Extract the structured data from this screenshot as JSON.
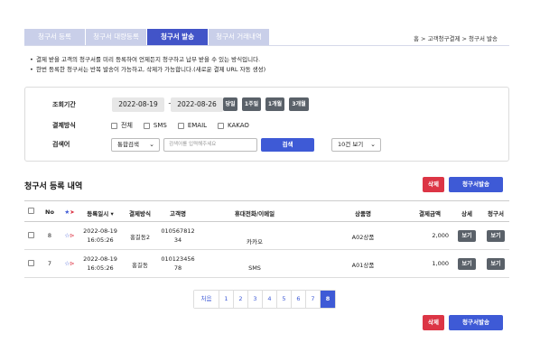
{
  "tabs": [
    {
      "label": "청구서 등록",
      "active": false
    },
    {
      "label": "청구서 대량등록",
      "active": false
    },
    {
      "label": "청구서 발송",
      "active": true
    },
    {
      "label": "청구서 거래내역",
      "active": false
    }
  ],
  "breadcrumb": "홈 > 고객청구결제 > 청구서 발송",
  "notes": [
    "결제 받을 고객의 청구서를 미리 등록하여 언제든지 청구하고 납부 받을 수 있는 방식입니다.",
    "한번 등록한 청구서는 반복 발송이 가능하고, 삭제가 가능합니다.(새로운 결제 URL 자동 생성)"
  ],
  "search": {
    "period_label": "조회기간",
    "date_from": "2022-08-19",
    "date_sep": "~",
    "date_to": "2022-08-26",
    "presets": [
      "당일",
      "1주일",
      "1개월",
      "3개월"
    ],
    "method_label": "결제방식",
    "methods": [
      "전체",
      "SMS",
      "EMAIL",
      "KAKAO"
    ],
    "keyword_label": "검색어",
    "keyword_type": "통합검색",
    "keyword_placeholder": "검색어를 입력해주세요",
    "search_button": "검색",
    "page_size": "10건 보기"
  },
  "list": {
    "title": "청구서 등록 내역",
    "delete_button": "삭제",
    "send_button": "청구서발송"
  },
  "table": {
    "headers": {
      "no": "No",
      "date": "등록일시",
      "method": "결제방식",
      "customer": "고객명",
      "contact": "휴대전화/이메일",
      "product": "상품명",
      "amount": "결제금액",
      "detail": "상세",
      "invoice": "청구서"
    },
    "rows": [
      {
        "no": "8",
        "date": "2022-08-19",
        "time": "16:05:26",
        "method": "홍길동2",
        "customer_a": "010567812",
        "customer_b": "34",
        "contact": "카카오",
        "product": "A02상품",
        "amount": "2,000",
        "detail": "보기",
        "invoice": "보기"
      },
      {
        "no": "7",
        "date": "2022-08-19",
        "time": "16:05:26",
        "method": "홍길동",
        "customer_a": "010123456",
        "customer_b": "78",
        "contact": "SMS",
        "product": "A01상품",
        "amount": "1,000",
        "detail": "보기",
        "invoice": "보기"
      }
    ]
  },
  "pagination": {
    "first": "처음",
    "pages": [
      "1",
      "2",
      "3",
      "4",
      "5",
      "6",
      "7",
      "8"
    ],
    "current": "8"
  },
  "footer": {
    "delete_button": "삭제",
    "send_button": "청구서발송"
  },
  "colors": {
    "primary": "#3e5ad6",
    "tab_active": "#4254c8",
    "tab_inactive": "#c9cfe9",
    "danger": "#dc3545",
    "secondary": "#5a6169"
  }
}
